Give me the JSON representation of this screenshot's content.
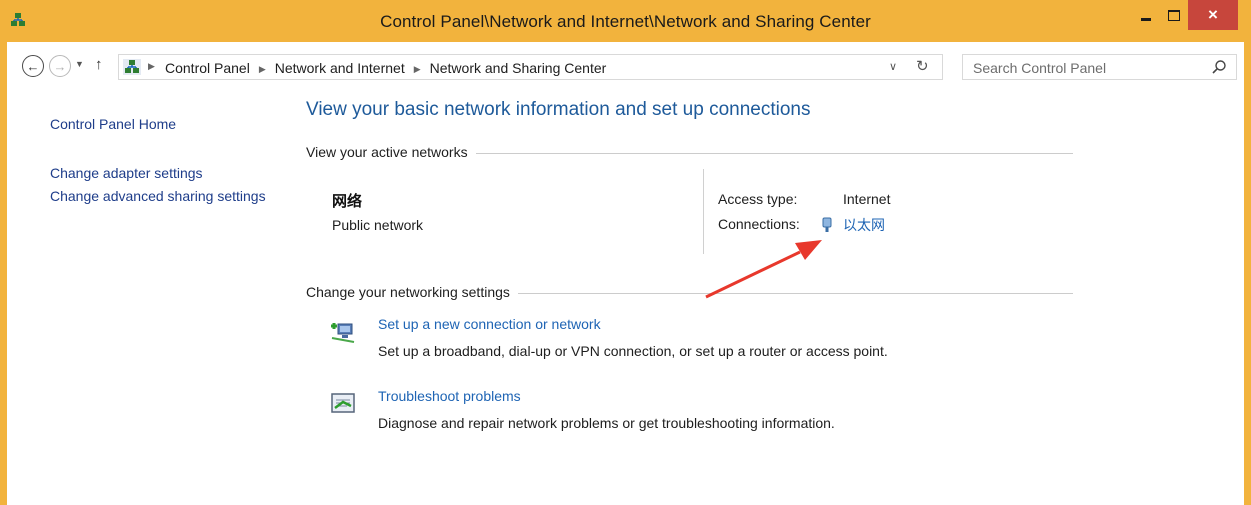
{
  "window": {
    "title": "Control Panel\\Network and Internet\\Network and Sharing Center",
    "close_glyph": "×",
    "icon": "network-center-icon"
  },
  "nav": {
    "back_glyph": "←",
    "forward_glyph": "→",
    "recent_glyph": "▼",
    "up_glyph": "↑"
  },
  "address": {
    "crumbs": [
      "Control Panel",
      "Network and Internet",
      "Network and Sharing Center"
    ],
    "separator": "▶",
    "dropdown_glyph": "∨",
    "refresh_glyph": "↻"
  },
  "search": {
    "placeholder": "Search Control Panel"
  },
  "sidebar": {
    "home": "Control Panel Home",
    "links": [
      "Change adapter settings",
      "Change advanced sharing settings"
    ]
  },
  "main": {
    "title": "View your basic network information and set up connections",
    "active_header": "View your active networks",
    "network": {
      "name": "网络",
      "type": "Public network",
      "access_label": "Access type:",
      "access_value": "Internet",
      "connections_label": "Connections:",
      "connection_name": "以太网"
    },
    "settings_header": "Change your networking settings",
    "tasks": [
      {
        "link": "Set up a new connection or network",
        "desc": "Set up a broadband, dial-up or VPN connection, or set up a router or access point."
      },
      {
        "link": "Troubleshoot problems",
        "desc": "Diagnose and repair network problems or get troubleshooting information."
      }
    ]
  },
  "colors": {
    "frame": "#f2b33d",
    "link": "#1e64b4",
    "annotation_arrow": "#e8382c"
  }
}
